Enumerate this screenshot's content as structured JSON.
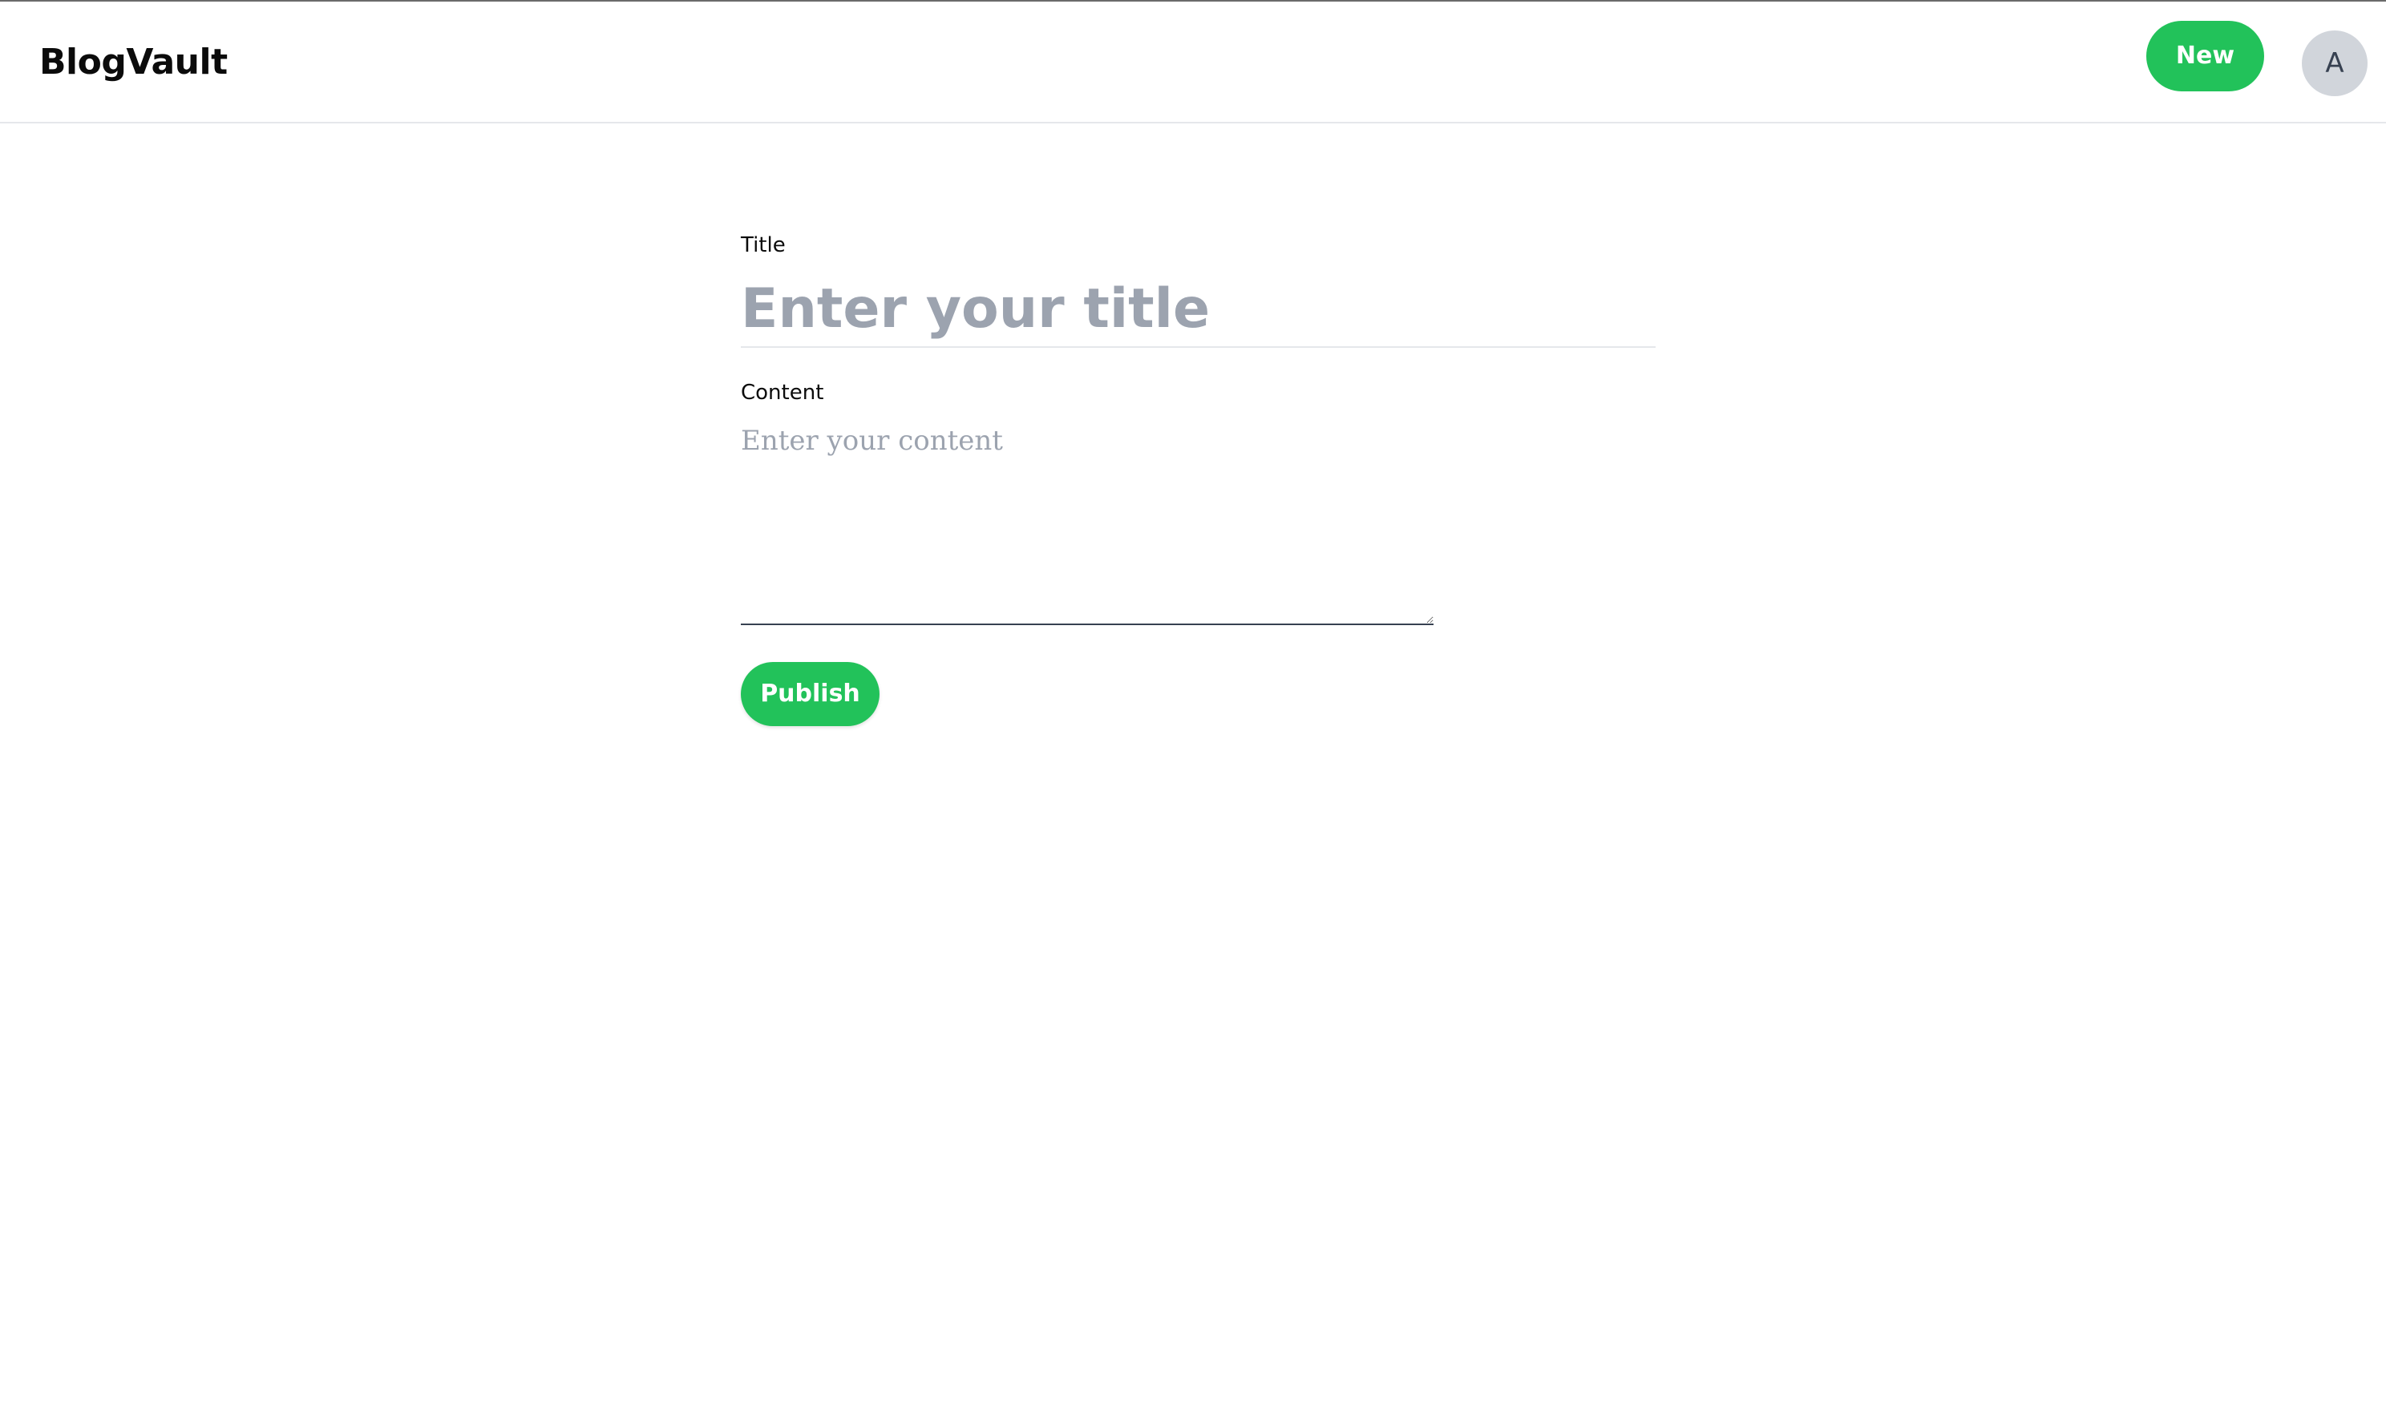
{
  "header": {
    "brand": "BlogVault",
    "new_label": "New",
    "avatar_initial": "A"
  },
  "form": {
    "title_label": "Title",
    "title_placeholder": "Enter your title",
    "title_value": "",
    "content_label": "Content",
    "content_placeholder": "Enter your content",
    "content_value": "",
    "publish_label": "Publish"
  },
  "colors": {
    "accent": "#22c25a",
    "placeholder": "#9ca3af",
    "avatar_bg": "#d1d5db",
    "divider": "#e5e7eb"
  }
}
